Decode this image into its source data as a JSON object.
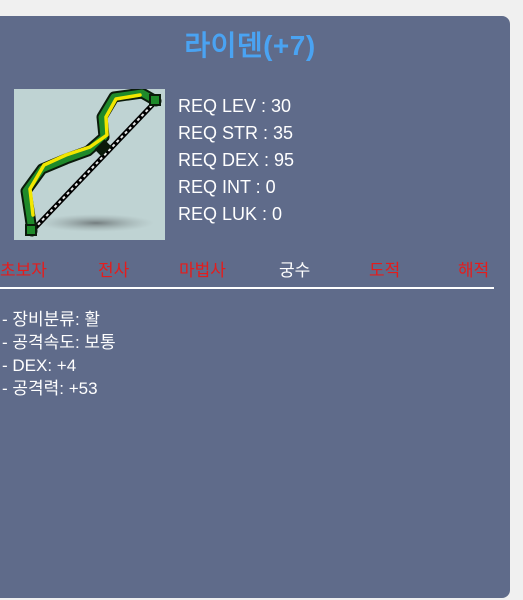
{
  "item": {
    "name": "라이덴(+7)",
    "icon": "bow-icon"
  },
  "requirements": [
    "REQ LEV : 30",
    "REQ STR : 35",
    "REQ DEX : 95",
    "REQ INT : 0",
    "REQ LUK : 0"
  ],
  "jobs": [
    {
      "label": "초보자",
      "active": false
    },
    {
      "label": "전사",
      "active": false
    },
    {
      "label": "마법사",
      "active": false
    },
    {
      "label": "궁수",
      "active": true
    },
    {
      "label": "도적",
      "active": false
    },
    {
      "label": "해적",
      "active": false
    }
  ],
  "stats": [
    "- 장비분류: 활",
    "- 공격속도: 보통",
    "- DEX: +4",
    "- 공격력: +53"
  ],
  "colors": {
    "panel": "#5f6b8a",
    "title": "#4aa3f2",
    "job_inactive": "#e51c1c",
    "job_active": "#ffffff"
  }
}
